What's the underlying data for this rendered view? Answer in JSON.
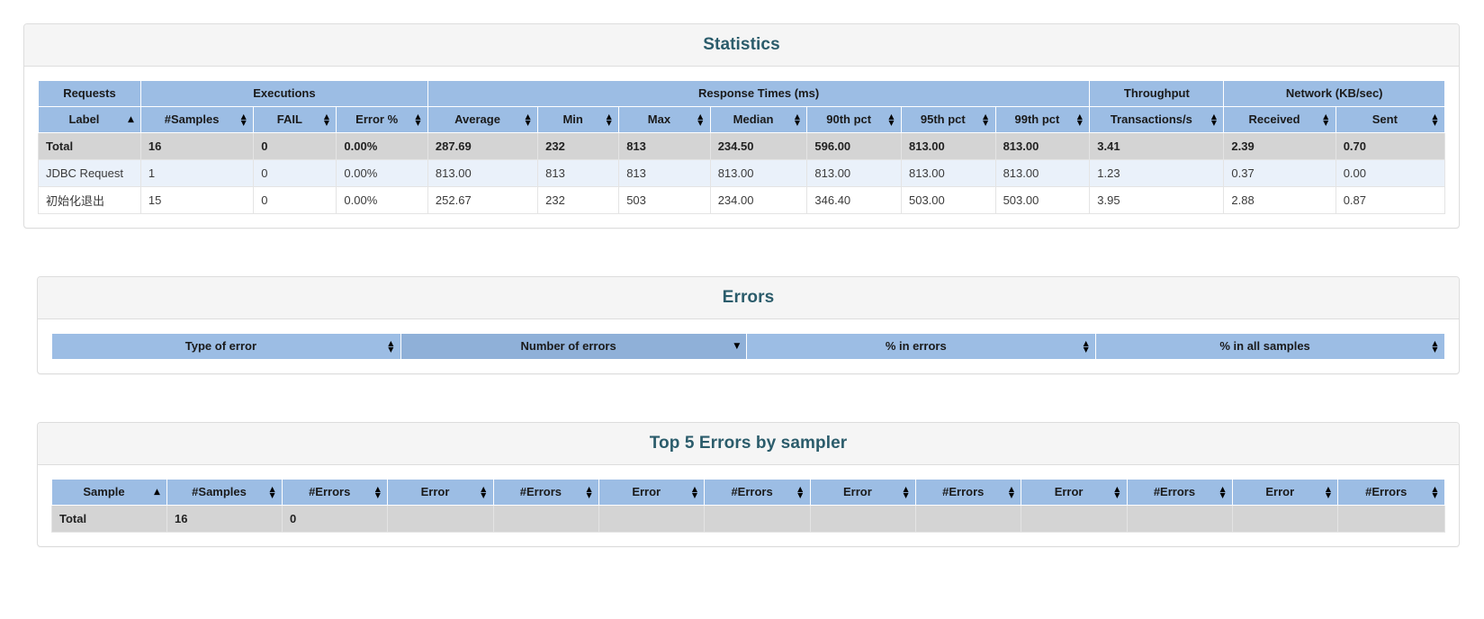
{
  "statistics": {
    "title": "Statistics",
    "group_headers": [
      {
        "label": "Requests",
        "span": 1
      },
      {
        "label": "Executions",
        "span": 3
      },
      {
        "label": "Response Times (ms)",
        "span": 7
      },
      {
        "label": "Throughput",
        "span": 1
      },
      {
        "label": "Network (KB/sec)",
        "span": 2
      }
    ],
    "columns": [
      {
        "label": "Label",
        "sort": "asc"
      },
      {
        "label": "#Samples",
        "sort": "both"
      },
      {
        "label": "FAIL",
        "sort": "both"
      },
      {
        "label": "Error %",
        "sort": "both"
      },
      {
        "label": "Average",
        "sort": "both"
      },
      {
        "label": "Min",
        "sort": "both"
      },
      {
        "label": "Max",
        "sort": "both"
      },
      {
        "label": "Median",
        "sort": "both"
      },
      {
        "label": "90th pct",
        "sort": "both"
      },
      {
        "label": "95th pct",
        "sort": "both"
      },
      {
        "label": "99th pct",
        "sort": "both"
      },
      {
        "label": "Transactions/s",
        "sort": "both"
      },
      {
        "label": "Received",
        "sort": "both"
      },
      {
        "label": "Sent",
        "sort": "both"
      }
    ],
    "rows": [
      {
        "kind": "total",
        "cells": [
          "Total",
          "16",
          "0",
          "0.00%",
          "287.69",
          "232",
          "813",
          "234.50",
          "596.00",
          "813.00",
          "813.00",
          "3.41",
          "2.39",
          "0.70"
        ]
      },
      {
        "kind": "odd",
        "cells": [
          "JDBC Request",
          "1",
          "0",
          "0.00%",
          "813.00",
          "813",
          "813",
          "813.00",
          "813.00",
          "813.00",
          "813.00",
          "1.23",
          "0.37",
          "0.00"
        ]
      },
      {
        "kind": "even",
        "cells": [
          "初始化退出",
          "15",
          "0",
          "0.00%",
          "252.67",
          "232",
          "503",
          "234.00",
          "346.40",
          "503.00",
          "503.00",
          "3.95",
          "2.88",
          "0.87"
        ]
      }
    ]
  },
  "errors": {
    "title": "Errors",
    "columns": [
      {
        "label": "Type of error",
        "sort": "both",
        "sorted": false
      },
      {
        "label": "Number of errors",
        "sort": "desc",
        "sorted": true
      },
      {
        "label": "% in errors",
        "sort": "both",
        "sorted": false
      },
      {
        "label": "% in all samples",
        "sort": "both",
        "sorted": false
      }
    ],
    "rows": []
  },
  "top5": {
    "title": "Top 5 Errors by sampler",
    "columns": [
      {
        "label": "Sample",
        "sort": "asc"
      },
      {
        "label": "#Samples",
        "sort": "both"
      },
      {
        "label": "#Errors",
        "sort": "both"
      },
      {
        "label": "Error",
        "sort": "both"
      },
      {
        "label": "#Errors",
        "sort": "both"
      },
      {
        "label": "Error",
        "sort": "both"
      },
      {
        "label": "#Errors",
        "sort": "both"
      },
      {
        "label": "Error",
        "sort": "both"
      },
      {
        "label": "#Errors",
        "sort": "both"
      },
      {
        "label": "Error",
        "sort": "both"
      },
      {
        "label": "#Errors",
        "sort": "both"
      },
      {
        "label": "Error",
        "sort": "both"
      },
      {
        "label": "#Errors",
        "sort": "both"
      }
    ],
    "rows": [
      {
        "kind": "total",
        "cells": [
          "Total",
          "16",
          "0",
          "",
          "",
          "",
          "",
          "",
          "",
          "",
          "",
          "",
          ""
        ]
      }
    ]
  },
  "colors": {
    "header_blue": "#9cbde4",
    "header_blue_sorted": "#8fb0d8",
    "total_row_gray": "#d4d4d4",
    "odd_row_blue": "#eaf1fa",
    "title_teal": "#2b5c6b",
    "panel_heading_bg": "#f5f5f5",
    "panel_border": "#dddddd"
  }
}
